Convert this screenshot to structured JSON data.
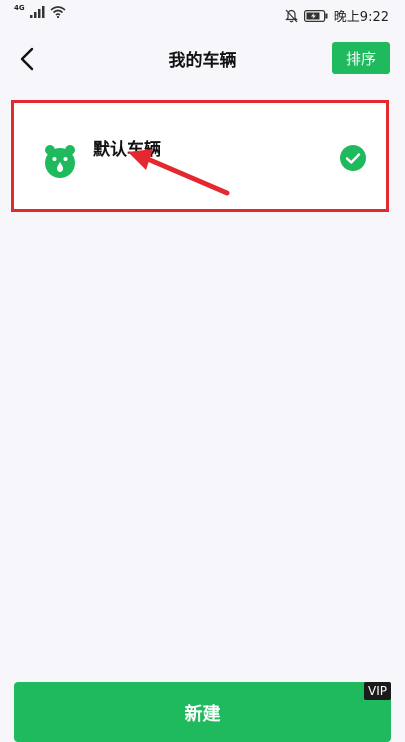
{
  "status_bar": {
    "network": "4G",
    "time": "晚上9:22"
  },
  "header": {
    "title": "我的车辆",
    "sort_label": "排序"
  },
  "vehicles": [
    {
      "name": "默认车辆",
      "selected": true
    }
  ],
  "footer": {
    "new_label": "新建",
    "vip_label": "VIP"
  },
  "colors": {
    "accent": "#1fb95e",
    "highlight": "#e3282f",
    "background": "#f7f6fa"
  },
  "icons": {
    "back": "chevron-left-icon",
    "vehicle": "bear-icon",
    "selected": "check-circle-icon"
  }
}
